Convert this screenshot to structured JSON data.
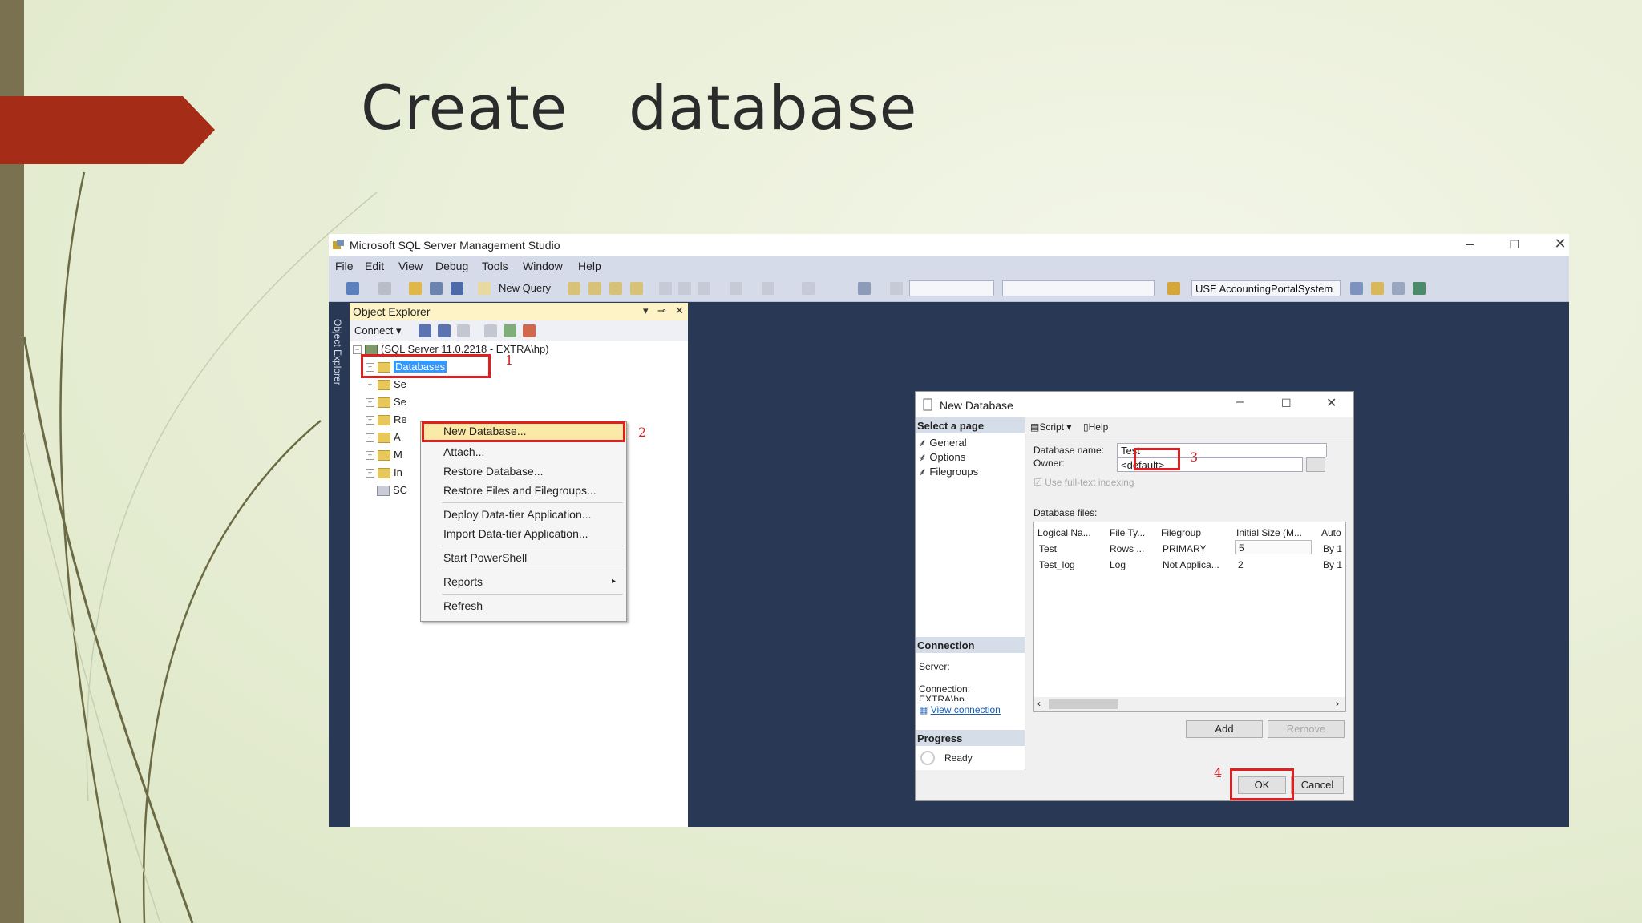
{
  "slide": {
    "title": "Create   database"
  },
  "window": {
    "title": "Microsoft SQL Server Management Studio"
  },
  "menu": [
    "File",
    "Edit",
    "View",
    "Debug",
    "Tools",
    "Window",
    "Help"
  ],
  "toolbar": {
    "new_query": "New Query",
    "db_selector": "USE AccountingPortalSystem"
  },
  "object_explorer": {
    "title": "Object Explorer",
    "side_label": "Object Explorer",
    "connect": "Connect ▾",
    "server": "(SQL Server 11.0.2218 - EXTRA\\hp)",
    "selected_node": "Databases",
    "truncated_nodes": [
      "Se",
      "Se",
      "Re",
      "A",
      "M",
      "In",
      "SC"
    ]
  },
  "context_menu": {
    "items": [
      "New Database...",
      "Attach...",
      "Restore Database...",
      "Restore Files and Filegroups...",
      "Deploy Data-tier Application...",
      "Import Data-tier Application...",
      "Start PowerShell",
      "Reports",
      "Refresh"
    ]
  },
  "annotations": [
    "1",
    "2",
    "3",
    "4"
  ],
  "dialog": {
    "title": "New Database",
    "select_page": "Select a page",
    "pages": [
      "General",
      "Options",
      "Filegroups"
    ],
    "script": "Script",
    "help": "Help",
    "db_name_label": "Database name:",
    "db_name_value": "Test",
    "owner_label": "Owner:",
    "owner_value": "<default>",
    "fulltext": "Use full-text indexing",
    "files_label": "Database files:",
    "columns": [
      "Logical Na...",
      "File Ty...",
      "Filegroup",
      "Initial Size (M...",
      "Auto"
    ],
    "rows": [
      [
        "Test",
        "Rows ...",
        "PRIMARY",
        "5",
        "By 1"
      ],
      [
        "Test_log",
        "Log",
        "Not Applica...",
        "2",
        "By 1"
      ]
    ],
    "connection_header": "Connection",
    "server_label": "Server:",
    "connection_label": "Connection:",
    "connection_value": "EXTRA\\hp",
    "view_connection": "View connection",
    "progress_header": "Progress",
    "progress_status": "Ready",
    "add": "Add",
    "remove": "Remove",
    "ok": "OK",
    "cancel": "Cancel"
  }
}
